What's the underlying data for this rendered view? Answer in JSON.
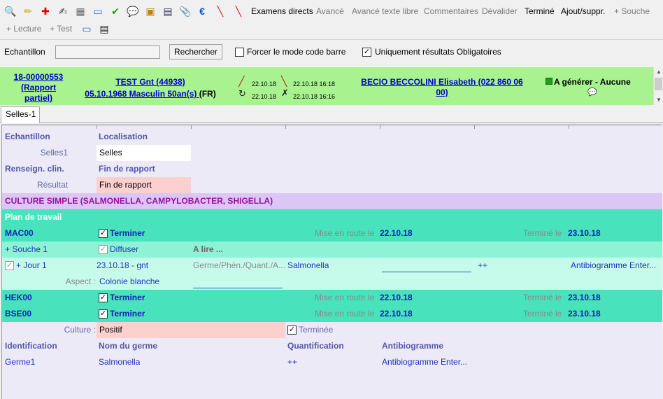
{
  "toolbar": {
    "icons": [
      {
        "name": "search-icon",
        "glyph": "🔍",
        "color": "#555555"
      },
      {
        "name": "pencil-icon",
        "glyph": "✏",
        "color": "#d4a000"
      },
      {
        "name": "add-red-cross-icon",
        "glyph": "✚",
        "color": "#e00000"
      },
      {
        "name": "edit-icon",
        "glyph": "✍",
        "color": "#444444"
      },
      {
        "name": "box-icon",
        "glyph": "▦",
        "color": "#666666"
      },
      {
        "name": "tube-icon",
        "glyph": "▭",
        "color": "#1b6fd0"
      },
      {
        "name": "checkmark-icon",
        "glyph": "✔",
        "color": "#14a014"
      },
      {
        "name": "comment-icon",
        "glyph": "💬",
        "color": "#c09000"
      },
      {
        "name": "report-icon",
        "glyph": "▣",
        "color": "#c08000"
      },
      {
        "name": "monitor-icon",
        "glyph": "▤",
        "color": "#333366"
      },
      {
        "name": "paperclip-icon",
        "glyph": "📎",
        "color": "#777777"
      },
      {
        "name": "euro-icon",
        "glyph": "€",
        "color": "#0a50c8"
      },
      {
        "name": "syringe-icon",
        "glyph": "╲",
        "color": "#c81e1e"
      },
      {
        "name": "syringe-add-icon",
        "glyph": "╲",
        "color": "#c81e1e"
      }
    ],
    "items": [
      {
        "label": "Examens directs",
        "state": "active"
      },
      {
        "label": "Avancé",
        "state": "dim"
      },
      {
        "label": "Avancé texte libre",
        "state": "dim"
      },
      {
        "label": "Commentaires",
        "state": "dim"
      },
      {
        "label": "Dévalider",
        "state": "dim"
      },
      {
        "label": "Terminé",
        "state": "active"
      },
      {
        "label": "Ajout/suppr.",
        "state": "active"
      },
      {
        "label": "+ Souche",
        "state": "dim"
      }
    ],
    "row2_items": [
      {
        "label": "+ Lecture",
        "state": "dim"
      },
      {
        "label": "+ Test",
        "state": "dim"
      }
    ],
    "row2_icons": [
      {
        "name": "tube-icon",
        "glyph": "▭",
        "color": "#1b6fd0"
      },
      {
        "name": "document-icon",
        "glyph": "▤",
        "color": "#222222"
      }
    ]
  },
  "search": {
    "label": "Echantillon",
    "value": "",
    "button": "Rechercher",
    "force_barcode": {
      "label": "Forcer le mode code barre",
      "checked": false
    },
    "mandatory_only": {
      "label": "Uniquement résultats Obligatoires",
      "checked": true
    }
  },
  "patient": {
    "sample_id_line1": "18-00000553",
    "sample_id_line2": "(Rapport",
    "sample_id_line3": "partiel)",
    "name_line1": "TEST Gnt (44938)",
    "name_line2_link": "05.10.1968 Masculin 50an(s) ",
    "name_line2_suffix": "(FR)",
    "dates": [
      "22.10.18",
      "22.10.18 16:18",
      "22.10.18",
      "22.10.18 16:16"
    ],
    "doctor_line1": "BECIO BECCOLINI Elisabeth (022 860 06",
    "doctor_line2": "00)",
    "status": "A générer - Aucune",
    "status_color": "#1aa01a"
  },
  "tabs": [
    {
      "label": "Selles-1",
      "active": true
    }
  ],
  "grid": {
    "header1": {
      "col1": "Echantillon",
      "col2": "Localisation"
    },
    "row_selles": {
      "label": "Selles1",
      "value": "Selles"
    },
    "header2": {
      "col1": "Renseign. clin.",
      "col2": "Fin de rapport"
    },
    "row_resultat": {
      "label": "Résultat",
      "value": "Fin de rapport"
    },
    "culture_title": "CULTURE SIMPLE (SALMONELLA, CAMPYLOBACTER, SHIGELLA)",
    "plan_title": "Plan de travail",
    "mise_label": "Mise en route le",
    "termine_label": "Terminé le",
    "terminer_label": "Terminer",
    "tasks": [
      {
        "code": "MAC00",
        "mise": "22.10.18",
        "termine": "23.10.18"
      },
      {
        "code": "HEK00",
        "mise": "22.10.18",
        "termine": "23.10.18"
      },
      {
        "code": "BSE00",
        "mise": "22.10.18",
        "termine": "23.10.18"
      }
    ],
    "souche": {
      "label": "+ Souche 1",
      "diffuser": "Diffuser",
      "a_lire": "A lire ..."
    },
    "jour": {
      "label": "+ Jour 1",
      "date": "23.10.18 - gnt",
      "germ_label": "Germe/Phén./Quant./A...",
      "germ": "Salmonella",
      "plus": "++",
      "antibio": "Antibiogramme Enter..."
    },
    "aspect": {
      "label": "Aspect :",
      "value": "Colonie blanche"
    },
    "culture": {
      "label": "Culture :",
      "value": "Positif",
      "terminee": "Terminée"
    },
    "ident_headers": [
      "Identification",
      "Nom du germe",
      "Quantification",
      "Antibiogramme"
    ],
    "germe_row": [
      "Germe1",
      "Salmonella",
      "++",
      "Antibiogramme Enter..."
    ]
  }
}
